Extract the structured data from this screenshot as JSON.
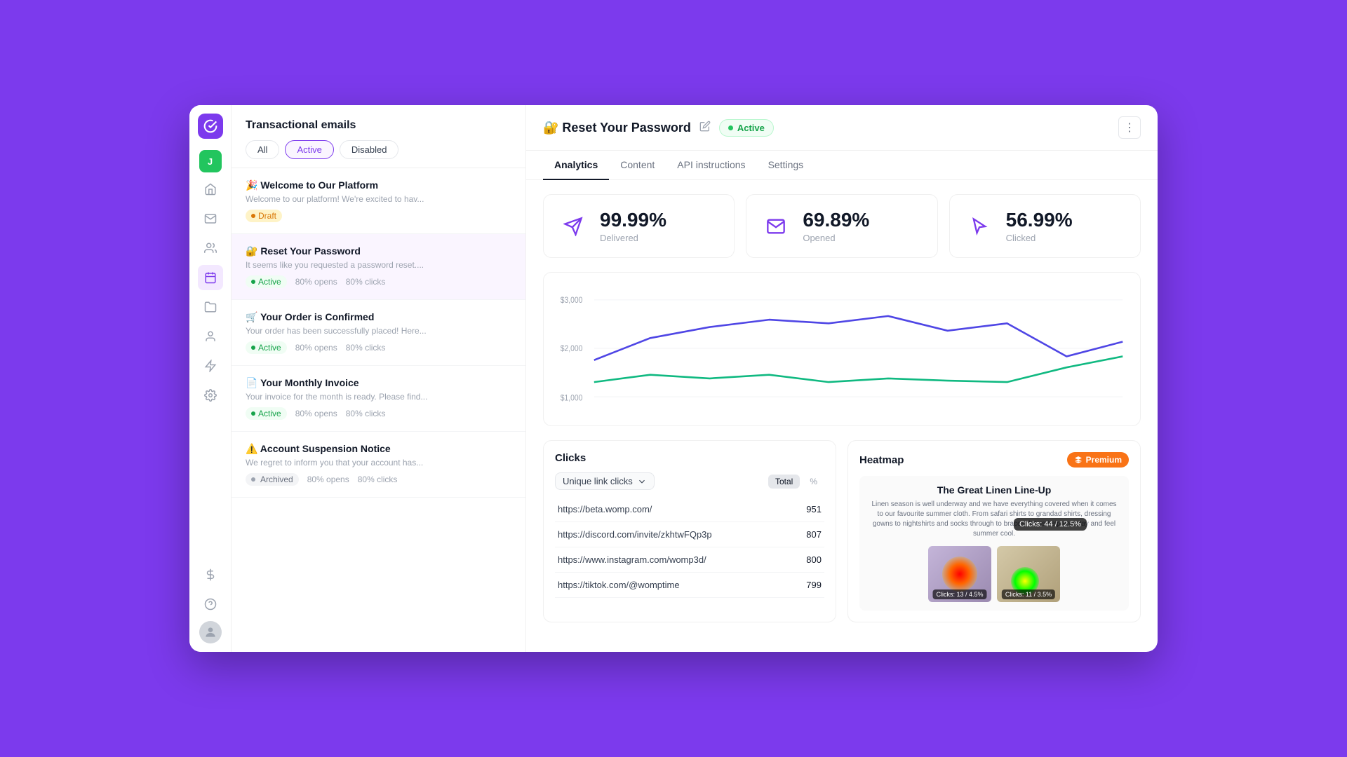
{
  "app": {
    "logo_letter": "▲",
    "user_initial": "J"
  },
  "left_panel": {
    "title": "Transactional emails",
    "filter_buttons": [
      {
        "label": "All",
        "key": "all"
      },
      {
        "label": "Active",
        "key": "active"
      },
      {
        "label": "Disabled",
        "key": "disabled"
      }
    ],
    "emails": [
      {
        "icon": "🎉",
        "title": "Welcome to Our Platform",
        "preview": "Welcome to our platform! We're excited to hav...",
        "badge": "draft",
        "badge_label": "Draft",
        "opens": null,
        "clicks": null
      },
      {
        "icon": "🔐",
        "title": "Reset Your Password",
        "preview": "It seems like you requested a password reset....",
        "badge": "active",
        "badge_label": "Active",
        "opens": "80% opens",
        "clicks": "80% clicks"
      },
      {
        "icon": "🛒",
        "title": "Your Order is Confirmed",
        "preview": "Your order has been successfully placed! Here...",
        "badge": "active",
        "badge_label": "Active",
        "opens": "80% opens",
        "clicks": "80% clicks"
      },
      {
        "icon": "📄",
        "title": "Your Monthly Invoice",
        "preview": "Your invoice for the month is ready. Please find...",
        "badge": "active",
        "badge_label": "Active",
        "opens": "80% opens",
        "clicks": "80% clicks"
      },
      {
        "icon": "⚠️",
        "title": "Account Suspension Notice",
        "preview": "We regret to inform you that your account has...",
        "badge": "archived",
        "badge_label": "Archived",
        "opens": "80% opens",
        "clicks": "80% clicks"
      }
    ]
  },
  "main": {
    "header": {
      "icon": "🔐",
      "title": "Reset Your Password",
      "status": "Active",
      "more_button": "⋮"
    },
    "tabs": [
      {
        "label": "Analytics",
        "key": "analytics",
        "active": true
      },
      {
        "label": "Content",
        "key": "content"
      },
      {
        "label": "API instructions",
        "key": "api"
      },
      {
        "label": "Settings",
        "key": "settings"
      }
    ],
    "stats": [
      {
        "icon_type": "send",
        "value": "99.99%",
        "label": "Delivered"
      },
      {
        "icon_type": "open",
        "value": "69.89%",
        "label": "Opened"
      },
      {
        "icon_type": "click",
        "value": "56.99%",
        "label": "Clicked"
      }
    ],
    "chart": {
      "y_labels": [
        "$3,000",
        "$2,000",
        "$1,000"
      ],
      "line1_color": "#4f46e5",
      "line2_color": "#10b981"
    },
    "clicks": {
      "section_title": "Clicks",
      "filter_label": "Unique link clicks",
      "total_btn": "Total",
      "pct_btn": "%",
      "rows": [
        {
          "url": "https://beta.womp.com/",
          "count": "951"
        },
        {
          "url": "https://discord.com/invite/zkhtwFQp3p",
          "count": "807"
        },
        {
          "url": "https://www.instagram.com/womp3d/",
          "count": "800"
        },
        {
          "url": "https://tiktok.com/@womptime",
          "count": "799"
        }
      ]
    },
    "heatmap": {
      "section_title": "Heatmap",
      "premium_label": "Premium",
      "email_title": "The Great Linen Line-Up",
      "email_body": "Linen season is well underway and we have everything covered when it comes to our favourite summer cloth. From safari shirts to grandad shirts, dressing gowns to nightshirts and socks through to braces, let us help you stay and feel summer cool.",
      "tooltip": "Clicks: 44 / 12.5%",
      "img1_badge": "Clicks: 13 / 4.5%",
      "img2_badge": "Clicks: 11 / 3.5%"
    }
  },
  "sidebar": {
    "icons": [
      {
        "name": "home",
        "symbol": "⌂",
        "active": false
      },
      {
        "name": "email",
        "symbol": "✉",
        "active": false
      },
      {
        "name": "contacts",
        "symbol": "👥",
        "active": false
      },
      {
        "name": "campaigns",
        "symbol": "📋",
        "active": true
      },
      {
        "name": "folders",
        "symbol": "📁",
        "active": false
      },
      {
        "name": "team",
        "symbol": "👤",
        "active": false
      },
      {
        "name": "automation",
        "symbol": "⚡",
        "active": false
      },
      {
        "name": "settings",
        "symbol": "⚙",
        "active": false
      }
    ],
    "bottom_icons": [
      {
        "name": "billing",
        "symbol": "$"
      },
      {
        "name": "help",
        "symbol": "?"
      }
    ]
  }
}
